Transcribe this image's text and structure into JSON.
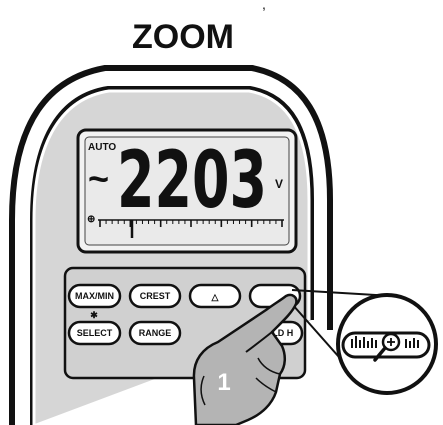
{
  "header": {
    "top_fragment": ",",
    "title": "ZOOM"
  },
  "display": {
    "auto_label": "AUTO",
    "ac_symbol": "~",
    "reading": "2203",
    "unit": "V",
    "bar_marker": "⊕"
  },
  "buttons": {
    "maxmin": "MAX/MIN",
    "crest": "CREST",
    "delta": "△",
    "select": "SELECT",
    "range": "RANGE",
    "holdh": "HOLD H",
    "select_star": "✱"
  },
  "zoom_callout": {
    "icon_name": "zoom-magnifier-icon"
  },
  "step": {
    "number": "1"
  }
}
